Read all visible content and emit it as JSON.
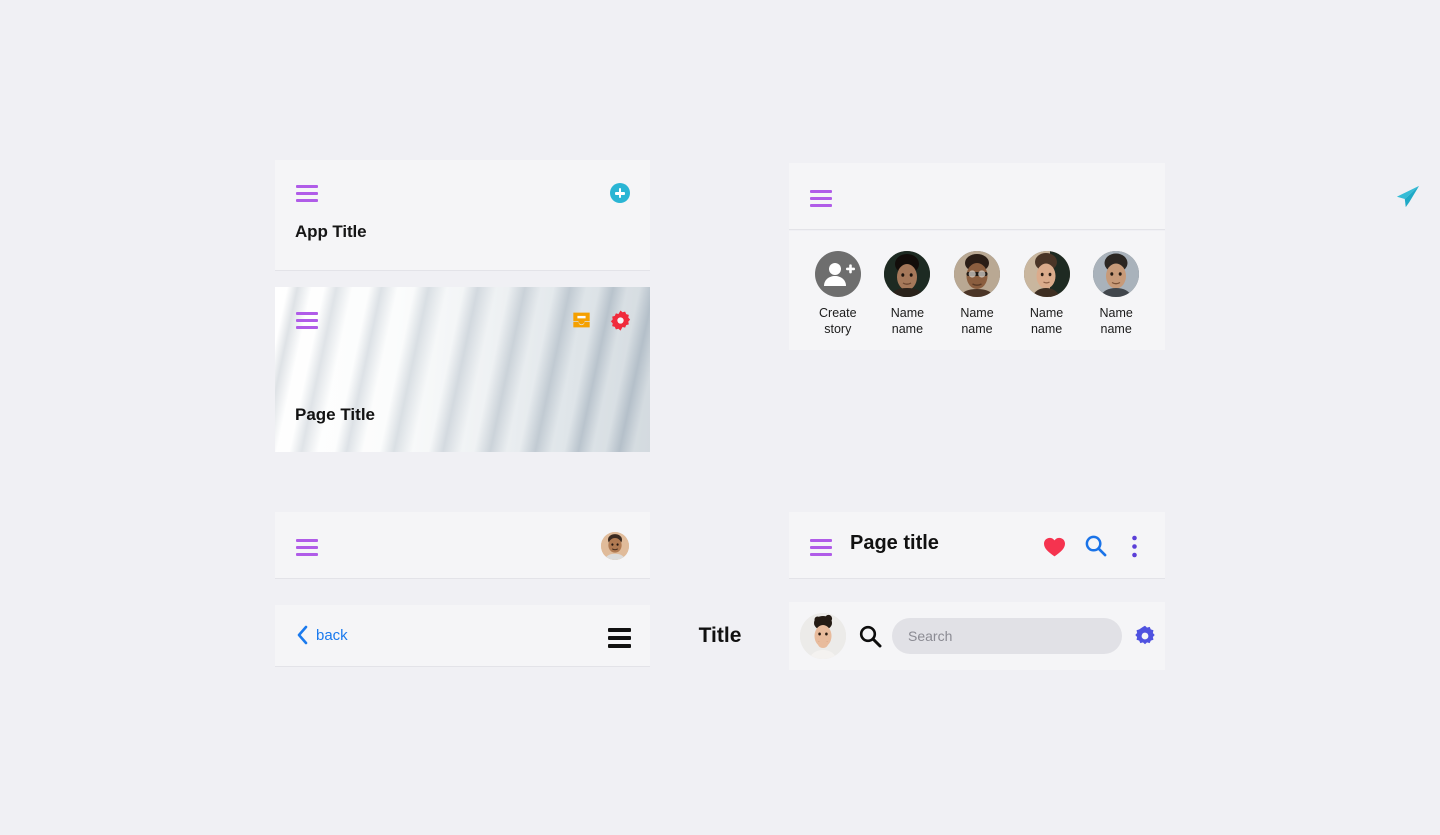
{
  "page": {
    "background_color": "#f0f0f4",
    "card_color": "#f5f5f7"
  },
  "colors": {
    "hamburger_purple": "#b05ce8",
    "plus_cyan": "#2ab5d4",
    "send_cyan": "#2ab5d4",
    "inbox_orange": "#f5a000",
    "gear_red": "#f02a3c",
    "gear_blue": "#4f52e0",
    "heart_red": "#f5334f",
    "search_blue": "#1a73e8",
    "dots_indigo": "#5b3fd8",
    "back_blue": "#1a7aee",
    "create_story_gray": "#6e6e6e"
  },
  "card_app_title": {
    "menu_icon": "hamburger-menu-icon",
    "add_icon": "plus-circle-icon",
    "title": "App Title"
  },
  "card_page_title": {
    "menu_icon": "hamburger-menu-icon",
    "inbox_icon": "inbox-icon",
    "settings_icon": "gear-icon",
    "title": "Page Title"
  },
  "card_avatar_bar": {
    "menu_icon": "hamburger-menu-icon",
    "avatar_icon": "avatar"
  },
  "card_back_title": {
    "back_icon": "chevron-left-icon",
    "back_label": "back",
    "title": "Title",
    "menu_icon": "hamburger-menu-icon"
  },
  "card_stories_head": {
    "menu_icon": "hamburger-menu-icon",
    "send_icon": "paper-plane-icon"
  },
  "stories": {
    "items": [
      {
        "label_line1": "Create",
        "label_line2": "story",
        "icon": "add-person-icon",
        "type": "create"
      },
      {
        "label_line1": "Name",
        "label_line2": "name",
        "icon": "avatar",
        "type": "photo"
      },
      {
        "label_line1": "Name",
        "label_line2": "name",
        "icon": "avatar",
        "type": "photo"
      },
      {
        "label_line1": "Name",
        "label_line2": "name",
        "icon": "avatar",
        "type": "photo"
      },
      {
        "label_line1": "Name",
        "label_line2": "name",
        "icon": "avatar",
        "type": "photo"
      }
    ]
  },
  "card_page_actions": {
    "menu_icon": "hamburger-menu-icon",
    "title": "Page title",
    "favorite_icon": "heart-icon",
    "search_icon": "search-icon",
    "overflow_icon": "more-vertical-icon"
  },
  "card_search": {
    "avatar_icon": "avatar",
    "search_icon": "search-icon",
    "search_value": "",
    "search_placeholder": "Search",
    "settings_icon": "gear-icon"
  }
}
